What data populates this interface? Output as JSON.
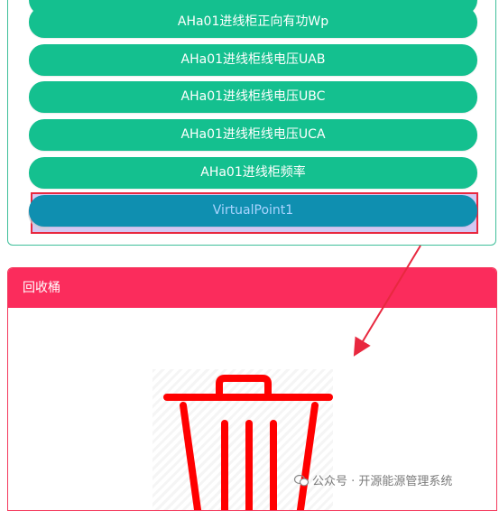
{
  "list": {
    "items": [
      {
        "label": "AHa01进线柜正向有功Wp"
      },
      {
        "label": "AHa01进线柜线电压UAB"
      },
      {
        "label": "AHa01进线柜线电压UBC"
      },
      {
        "label": "AHa01进线柜线电压UCA"
      },
      {
        "label": "AHa01进线柜频率"
      }
    ],
    "selected_item": {
      "label": "VirtualPoint1"
    }
  },
  "recycle": {
    "title": "回收桶",
    "icon": "trash-icon"
  },
  "watermark": {
    "text": "公众号 · 开源能源管理系统",
    "icon": "wechat-icon"
  },
  "colors": {
    "pill": "#14c08f",
    "selected_pill": "#0f8fb0",
    "recycle_header": "#fb2c5c",
    "highlight": "#e8283f"
  }
}
